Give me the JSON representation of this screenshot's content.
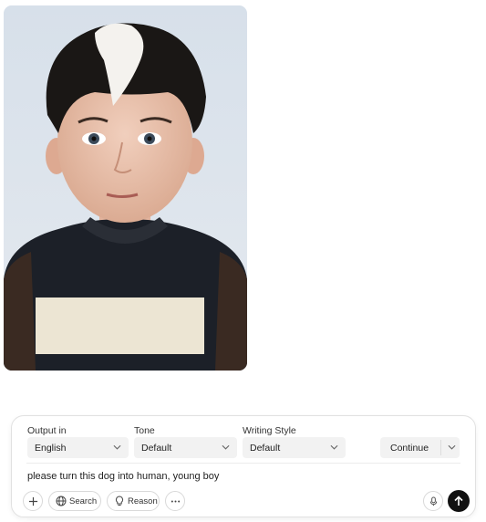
{
  "image": {
    "alt_icon": "portrait-photo"
  },
  "composer": {
    "output_label": "Output in",
    "output_value": "English",
    "tone_label": "Tone",
    "tone_value": "Default",
    "style_label": "Writing Style",
    "style_value": "Default",
    "continue_label": "Continue",
    "prompt_text": "please turn this dog into human, young boy",
    "search_label": "Search",
    "reason_label": "Reason"
  },
  "colors": {
    "send_button": "#111111",
    "field_bg": "#f2f2f2",
    "border": "#e1e1e1"
  }
}
